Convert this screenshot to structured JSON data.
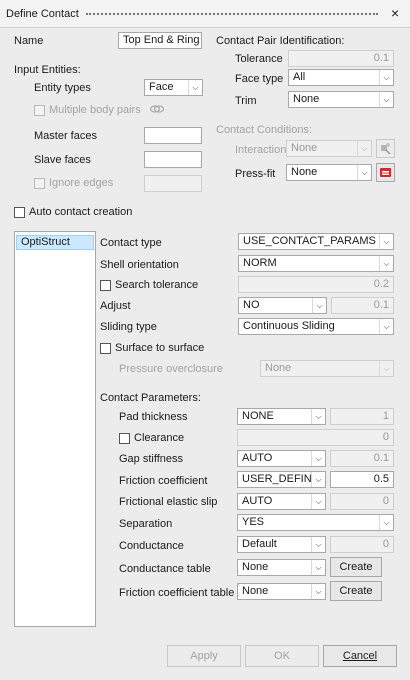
{
  "window": {
    "title": "Define Contact",
    "close": "×"
  },
  "name": {
    "label": "Name",
    "value": "Top End & Ring"
  },
  "input_entities": {
    "heading": "Input Entities:",
    "entity_types_label": "Entity types",
    "entity_types_value": "Face",
    "multiple_body_pairs": "Multiple body pairs",
    "master_faces": "Master faces",
    "slave_faces": "Slave faces",
    "ignore_edges": "Ignore edges"
  },
  "pair_identification": {
    "heading": "Contact Pair Identification:",
    "tolerance_label": "Tolerance",
    "tolerance_value": "0.1",
    "face_type_label": "Face type",
    "face_type_value": "All",
    "trim_label": "Trim",
    "trim_value": "None"
  },
  "contact_conditions": {
    "heading": "Contact Conditions:",
    "interaction_label": "Interaction",
    "interaction_value": "None",
    "press_fit_label": "Press-fit",
    "press_fit_value": "None"
  },
  "auto_contact": "Auto contact creation",
  "solver_list": [
    "OptiStruct"
  ],
  "params": {
    "contact_type_label": "Contact  type",
    "contact_type_value": "USE_CONTACT_PARAMS",
    "shell_orientation_label": "Shell orientation",
    "shell_orientation_value": "NORM",
    "search_tolerance_label": "Search tolerance",
    "search_tolerance_value": "0.2",
    "adjust_label": "Adjust",
    "adjust_value": "NO",
    "adjust_num": "0.1",
    "sliding_type_label": "Sliding type",
    "sliding_type_value": "Continuous Sliding",
    "surface_to_surface_label": "Surface to surface",
    "pressure_overclosure_label": "Pressure overclosure",
    "pressure_overclosure_value": "None"
  },
  "contact_parameters": {
    "heading": "Contact Parameters:",
    "pad_thickness_label": "Pad thickness",
    "pad_thickness_value": "NONE",
    "pad_thickness_num": "1",
    "clearance_label": "Clearance",
    "clearance_num": "0",
    "gap_stiffness_label": "Gap stiffness",
    "gap_stiffness_value": "AUTO",
    "gap_stiffness_num": "0.1",
    "friction_coefficient_label": "Friction coefficient",
    "friction_coefficient_value": "USER_DEFINE",
    "friction_coefficient_num": "0.5",
    "frictional_elastic_slip_label": "Frictional elastic slip",
    "frictional_elastic_slip_value": "AUTO",
    "frictional_elastic_slip_num": "0",
    "separation_label": "Separation",
    "separation_value": "YES",
    "conductance_label": "Conductance",
    "conductance_value": "Default",
    "conductance_num": "0",
    "conductance_table_label": "Conductance table",
    "conductance_table_value": "None",
    "friction_table_label": "Friction coefficient table",
    "friction_table_value": "None",
    "create_label": "Create"
  },
  "footer": {
    "apply": "Apply",
    "ok": "OK",
    "cancel": "Cancel"
  },
  "colors": {
    "accent_selection": "#cce8ff",
    "press_fit_icon": "#d9262b"
  },
  "icons": [
    "close-icon",
    "dropdown-arrow-icon",
    "pair-link-icon",
    "interaction-tool-icon",
    "press-fit-icon"
  ]
}
